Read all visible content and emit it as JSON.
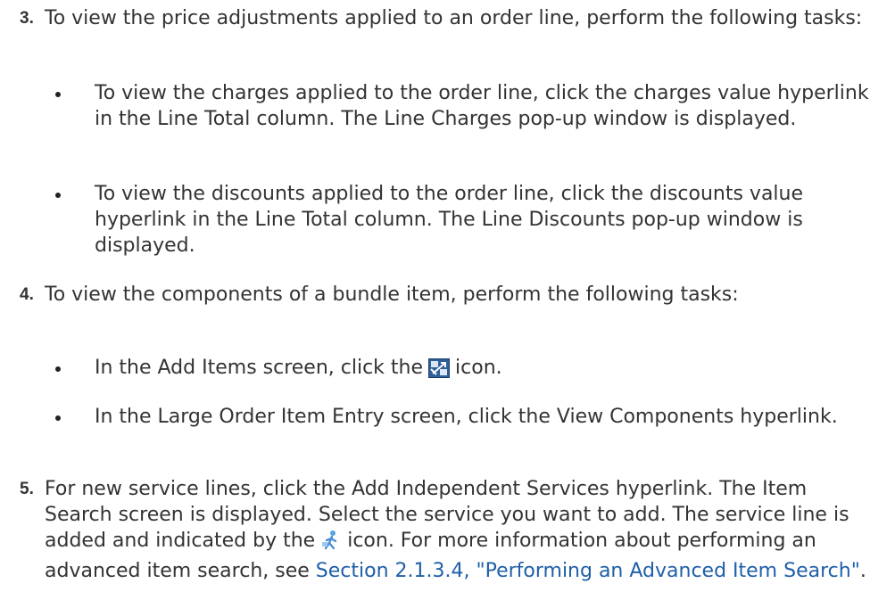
{
  "steps": [
    {
      "number": "3.",
      "text": "To view the price adjustments applied to an order line, perform the following tasks:",
      "bullets": [
        "To view the charges applied to the order line, click the charges value hyperlink in the Line Total column. The Line Charges pop-up window is displayed.",
        "To view the discounts applied to the order line, click the discounts value hyperlink in the Line Total column. The Line Discounts pop-up window is displayed."
      ]
    },
    {
      "number": "4.",
      "text": "To view the components of a bundle item, perform the following tasks:",
      "bullets": [
        {
          "before": "In the Add Items screen, click the",
          "icon": "bundle-components-icon",
          "after": "icon."
        },
        "In the Large Order Item Entry screen, click the View Components hyperlink."
      ]
    },
    {
      "number": "5.",
      "text_before": "For new service lines, click the Add Independent Services hyperlink. The Item Search screen is displayed. Select the service you want to add. The service line is added and indicated by the",
      "icon": "service-line-icon",
      "text_after": "icon. For more information about performing an advanced item search, see",
      "link": "Section 2.1.3.4, \"Performing an Advanced Item Search\"",
      "end": "."
    }
  ]
}
